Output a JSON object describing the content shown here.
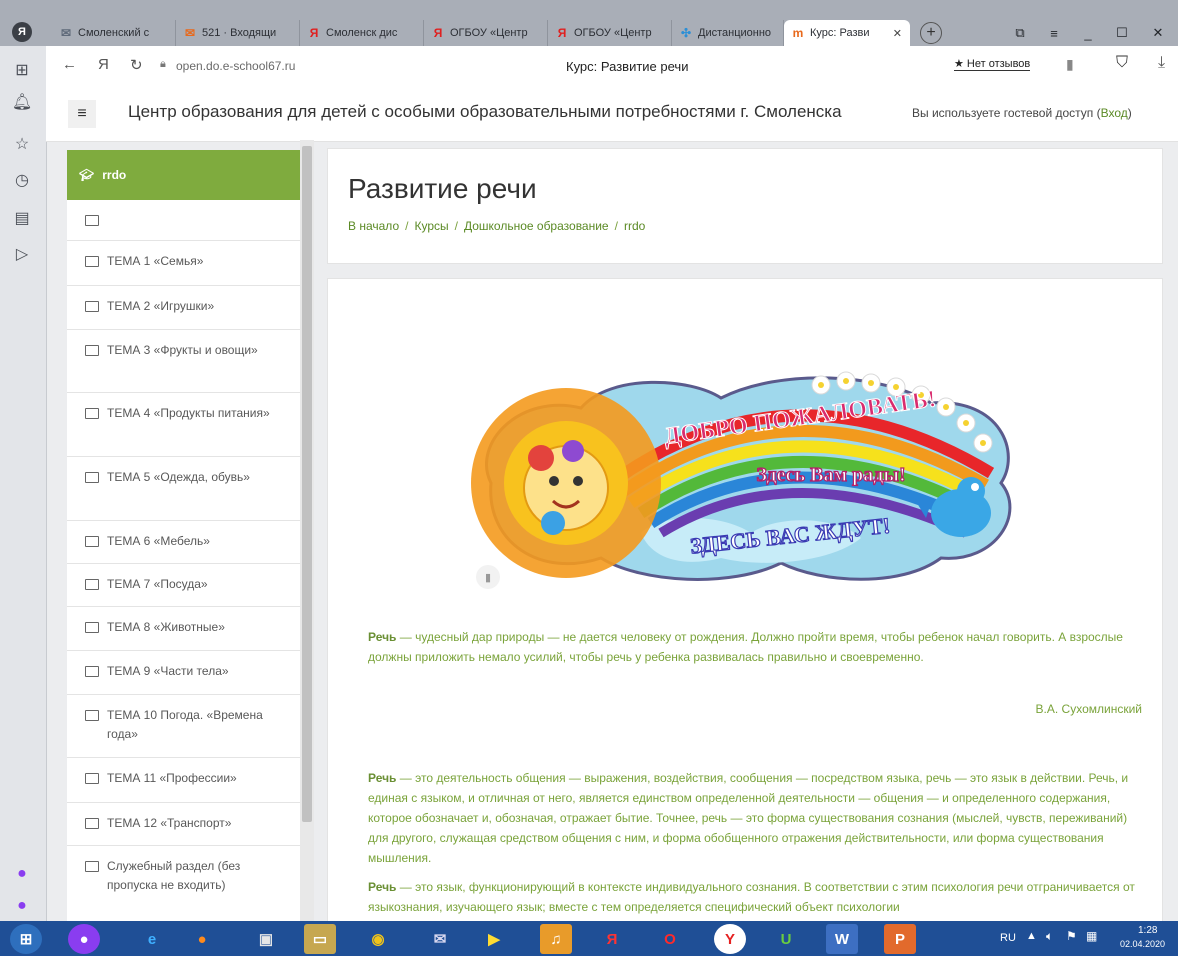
{
  "browser": {
    "tabs": [
      {
        "label": "Смоленский с",
        "icon": "envelope-icon"
      },
      {
        "label": "521 · Входящи",
        "icon": "mail-icon"
      },
      {
        "label": "Смоленск дис",
        "icon": "yandex-icon"
      },
      {
        "label": "ОГБОУ «Центр",
        "icon": "yandex-icon"
      },
      {
        "label": "ОГБОУ «Центр",
        "icon": "yandex-icon"
      },
      {
        "label": "Дистанционно",
        "icon": "puzzle-icon"
      },
      {
        "label": "Курс: Разви",
        "icon": "moodle-icon",
        "active": true
      }
    ],
    "new_tab": "+",
    "url": "open.do.e-school67.ru",
    "page_title": "Курс: Развитие речи",
    "reviews": "★ Нет отзывов"
  },
  "site": {
    "title": "Центр образования для детей с особыми образовательными потребностями г. Смоленска",
    "guest_text": "Вы используете гостевой доступ (",
    "login": "Вход",
    "guest_close": ")"
  },
  "sidebar": {
    "header": "rrdo",
    "items": [
      "",
      "ТЕМА 1 «Семья»",
      "ТЕМА 2 «Игрушки»",
      "ТЕМА 3 «Фрукты и овощи»",
      "ТЕМА 4 «Продукты питания»",
      "ТЕМА 5 «Одежда, обувь»",
      "ТЕМА 6 «Мебель»",
      "ТЕМА 7 «Посуда»",
      "ТЕМА 8 «Животные»",
      "ТЕМА 9 «Части тела»",
      "ТЕМА 10 Погода. «Времена года»",
      "ТЕМА 11 «Профессии»",
      "ТЕМА 12 «Транспорт»",
      "Служебный раздел (без пропуска не входить)"
    ]
  },
  "course": {
    "title": "Развитие речи",
    "breadcrumb": [
      "В начало",
      "Курсы",
      "Дошкольное образование",
      "rrdo"
    ]
  },
  "banner": {
    "line1": "ДОБРО ПОЖАЛОВАТЬ!",
    "line2": "Здесь Вам рады!",
    "line3": "ЗДЕСЬ ВАС ЖДУТ!"
  },
  "content": {
    "p1_term": "Речь",
    "p1_text": " — чудесный дар природы — не дается человеку от рождения. Должно пройти время, чтобы ребенок начал говорить. А взрослые должны приложить немало усилий, чтобы речь у ребенка развивалась правильно и своевременно.",
    "author": "В.А. Сухомлинский",
    "p2_term": "Речь",
    "p2_text": " — это деятельность общения — выражения, воздействия, сообщения — посредством языка, речь — это язык в действии. Речь, и единая с языком, и отличная от него, является единством определенной деятельности — общения — и определенного содержания, которое обозначает и, обозначая, отражает бытие. Точнее, речь — это форма существования сознания (мыслей, чувств, переживаний) для другого, служащая средством общения с ним, и форма обобщенного отражения действительности, или форма существования мышления.",
    "p3_term": "Речь",
    "p3_text": " — это язык, функционирующий в контексте индивидуального сознания. В соответствии с этим психология речи отграничивается от языкознания, изучающего язык; вместе с тем определяется специфический объект психологии"
  },
  "taskbar": {
    "lang": "RU",
    "time": "1:28",
    "date": "02.04.2020"
  },
  "colors": {
    "accent": "#7fab3e",
    "link": "#5b8a25",
    "taskbar": "#1f4f96"
  }
}
